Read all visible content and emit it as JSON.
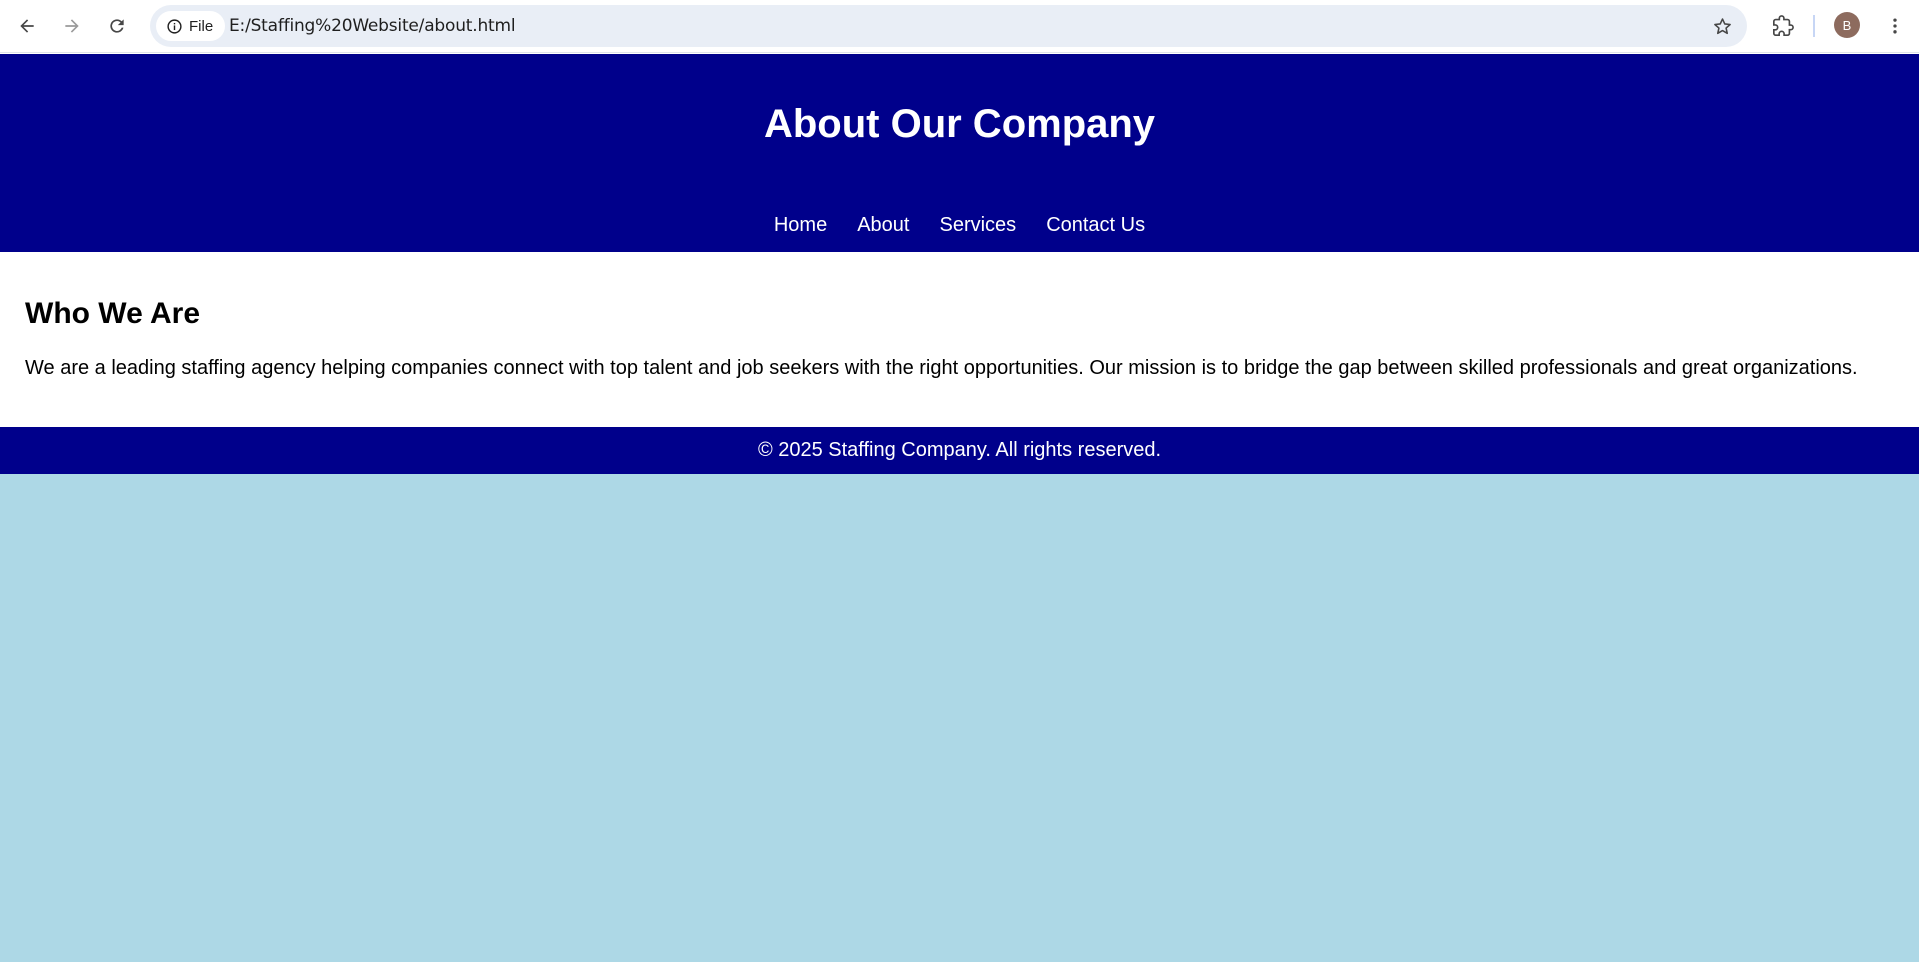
{
  "browser": {
    "site_chip_label": "File",
    "url": "E:/Staffing%20Website/about.html",
    "avatar_initial": "B",
    "icons": {
      "back": "arrow-left-icon",
      "forward": "arrow-right-icon",
      "reload": "reload-icon",
      "site_info": "info-icon",
      "bookmark": "star-icon",
      "extensions": "puzzle-icon",
      "menu": "kebab-menu-icon"
    }
  },
  "header": {
    "title": "About Our Company",
    "nav": [
      "Home",
      "About",
      "Services",
      "Contact Us"
    ]
  },
  "main": {
    "heading": "Who We Are",
    "paragraph": "We are a leading staffing agency helping companies connect with top talent and job seekers with the right opportunities. Our mission is to bridge the gap between skilled professionals and great organizations."
  },
  "footer": {
    "text": "© 2025 Staffing Company. All rights reserved."
  },
  "colors": {
    "header_bg": "#00008b",
    "footer_bg": "#00008b",
    "page_bg": "#add8e6",
    "section_bg": "#ffffff",
    "header_text": "#ffffff"
  }
}
